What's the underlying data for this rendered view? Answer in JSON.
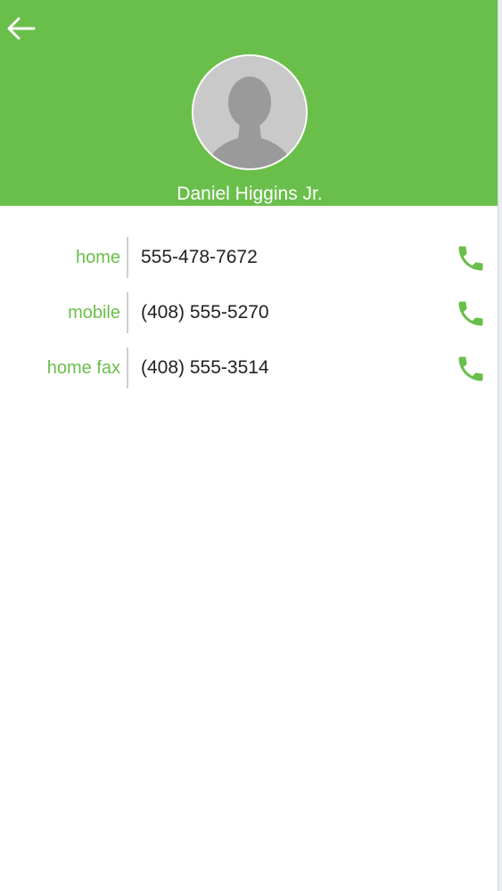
{
  "header": {
    "back_icon": "arrow-left-icon",
    "avatar_icon": "person-silhouette-icon",
    "name": "Daniel Higgins Jr."
  },
  "phones": [
    {
      "label": "home",
      "number": "555-478-7672",
      "icon": "phone-icon"
    },
    {
      "label": "mobile",
      "number": "(408) 555-5270",
      "icon": "phone-icon"
    },
    {
      "label": "home fax",
      "number": "(408) 555-3514",
      "icon": "phone-icon"
    }
  ],
  "colors": {
    "accent": "#6abf4b",
    "avatar_bg": "#c9c9c9",
    "avatar_silhouette": "#9a9a9a",
    "text": "#222222",
    "divider": "#cfcfcf"
  }
}
